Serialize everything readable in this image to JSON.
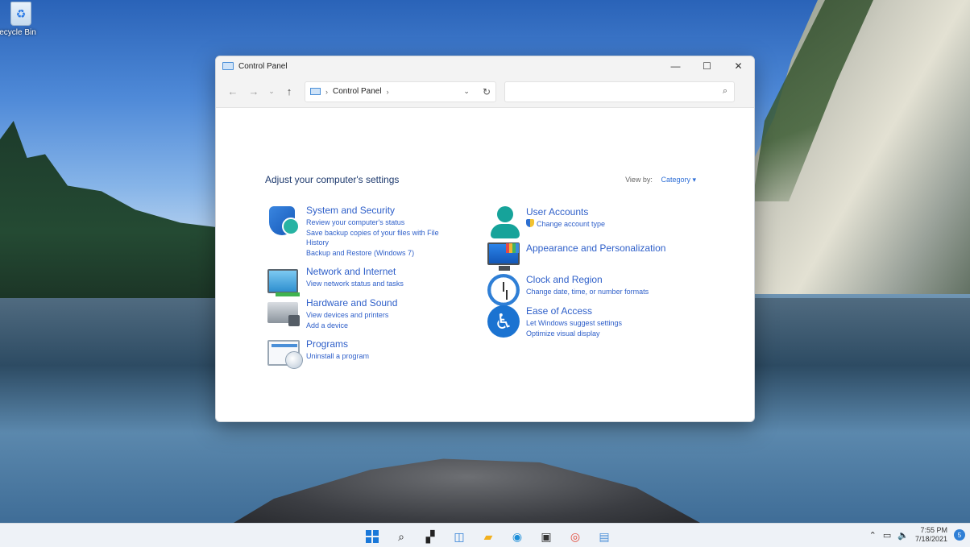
{
  "desktop": {
    "recycle_bin_label": "ecycle Bin"
  },
  "window": {
    "title": "Control Panel",
    "controls": {
      "minimize": "—",
      "maximize": "☐",
      "close": "✕"
    },
    "nav": {
      "back": "←",
      "forward": "→",
      "recent": "⌄",
      "up": "↑"
    },
    "address": {
      "separator": "›",
      "path": "Control Panel",
      "trail": "›",
      "dropdown": "⌄",
      "refresh": "↻"
    },
    "search": {
      "placeholder": "",
      "icon": "⌕"
    },
    "heading": "Adjust your computer's settings",
    "view_by": {
      "label": "View by:",
      "value": "Category ▾"
    },
    "categories_left": [
      {
        "icon": "shield-icon",
        "title": "System and Security",
        "links": [
          "Review your computer's status",
          "Save backup copies of your files with File",
          "History",
          "Backup and Restore (Windows 7)"
        ]
      },
      {
        "icon": "network-icon",
        "title": "Network and Internet",
        "links": [
          "View network status and tasks"
        ]
      },
      {
        "icon": "printer-icon",
        "title": "Hardware and Sound",
        "links": [
          "View devices and printers",
          "Add a device"
        ]
      },
      {
        "icon": "programs-icon",
        "title": "Programs",
        "links": [
          "Uninstall a program"
        ]
      }
    ],
    "categories_right": [
      {
        "icon": "user-icon",
        "title": "User Accounts",
        "links": [
          "Change account type"
        ]
      },
      {
        "icon": "monitor-palette-icon",
        "title": "Appearance and Personalization",
        "links": []
      },
      {
        "icon": "clock-icon",
        "title": "Clock and Region",
        "links": [
          "Change date, time, or number formats"
        ]
      },
      {
        "icon": "accessibility-icon",
        "title": "Ease of Access",
        "links": [
          "Let Windows suggest settings",
          "Optimize visual display"
        ]
      }
    ]
  },
  "taskbar": {
    "apps": [
      "start-icon",
      "search-icon",
      "task-view-icon",
      "widgets-icon",
      "file-explorer-icon",
      "edge-icon",
      "store-icon",
      "chrome-icon",
      "control-panel-icon"
    ],
    "tray": {
      "chevron": "⌃",
      "network": "▭",
      "volume": "🔈"
    },
    "time": "7:55 PM",
    "date": "7/18/2021",
    "notification_count": "5"
  },
  "colors": {
    "category_title": "#1e7a36",
    "link": "#2e5fc9",
    "accent": "#1a78d9"
  }
}
